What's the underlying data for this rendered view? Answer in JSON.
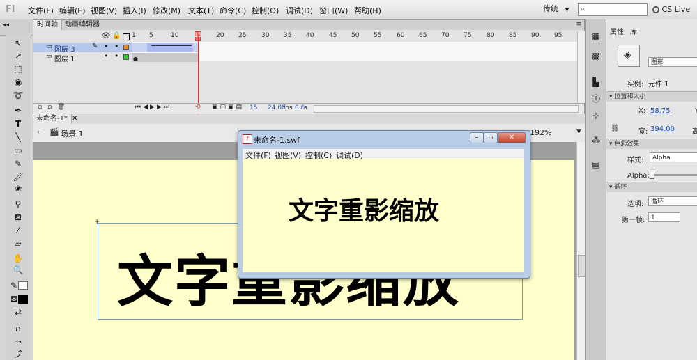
{
  "app": {
    "logo": "Fl"
  },
  "menu": [
    "文件(F)",
    "编辑(E)",
    "视图(V)",
    "插入(I)",
    "修改(M)",
    "文本(T)",
    "命令(C)",
    "控制(O)",
    "调试(D)",
    "窗口(W)",
    "帮助(H)"
  ],
  "workspace": {
    "label": "传统",
    "arrow": "▼"
  },
  "cslive": {
    "label": "CS Live"
  },
  "timeline": {
    "tabs": [
      "时间轴",
      "动画编辑器"
    ],
    "ruler": [
      "1",
      "5",
      "10",
      "15",
      "20",
      "25",
      "30",
      "35",
      "40",
      "45",
      "50",
      "55",
      "60",
      "65",
      "70",
      "75",
      "80",
      "85",
      "90",
      "95"
    ],
    "layers": [
      {
        "name": "图层 3",
        "color": "#e8862a"
      },
      {
        "name": "图层 1",
        "color": "#3ccc3c"
      }
    ],
    "frame": "15",
    "fps": "24.00",
    "fps_unit": "fps",
    "time": "0.6",
    "time_unit": "s"
  },
  "document": {
    "tab": "未命名-1*",
    "scene": "场景 1",
    "zoom": "192%"
  },
  "stage": {
    "text": "文字重影缩放"
  },
  "swf": {
    "title": "未命名-1.swf",
    "menu": [
      "文件(F)",
      "视图(V)",
      "控制(C)",
      "调试(D)"
    ],
    "text": "文字重影缩放"
  },
  "props": {
    "tabs": [
      "属性",
      "库"
    ],
    "symbol_type": "图形",
    "instance_label": "实例:",
    "instance_value": "元件 1",
    "sections": {
      "position": "位置和大小",
      "color": "色彩效果",
      "loop": "循环"
    },
    "x_label": "X:",
    "x_value": "58.75",
    "y_label": "Y",
    "w_label": "宽:",
    "w_value": "394.00",
    "h_label": "高",
    "style_label": "样式:",
    "style_value": "Alpha",
    "alpha_label": "Alpha:",
    "option_label": "选项:",
    "option_value": "循环",
    "firstframe_label": "第一帧:",
    "firstframe_value": "1"
  }
}
